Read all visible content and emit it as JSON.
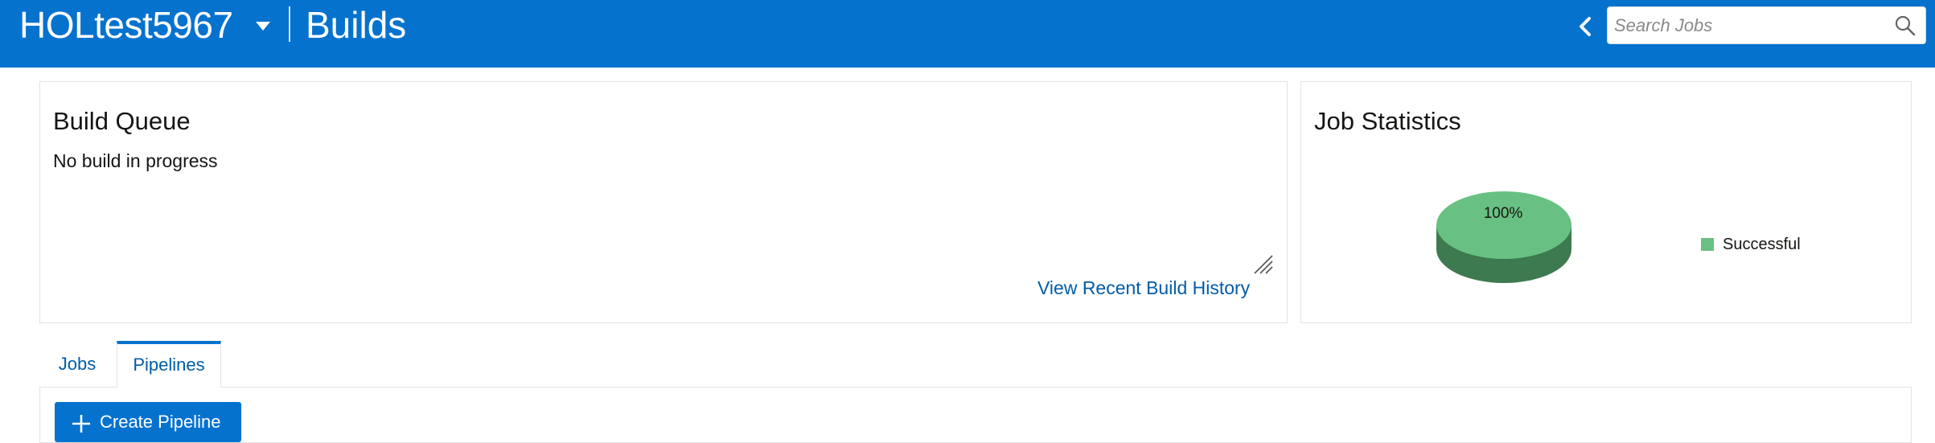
{
  "header": {
    "project_name": "HOLtest5967",
    "page_title": "Builds",
    "search_placeholder": "Search Jobs",
    "icons": [
      "chevron-down-icon",
      "chevron-left-icon",
      "search-icon"
    ]
  },
  "build_queue": {
    "title": "Build Queue",
    "status": "No build in progress",
    "history_link": "View Recent Build History"
  },
  "job_statistics": {
    "title": "Job Statistics",
    "slice_label": "100%",
    "legend_label": "Successful",
    "colors": {
      "successful": "#68c182",
      "successful_side": "#3d7a4f"
    }
  },
  "tabs": [
    {
      "label": "Jobs",
      "selected": false
    },
    {
      "label": "Pipelines",
      "selected": true
    }
  ],
  "pipelines": {
    "create_button": "Create Pipeline"
  },
  "colors": {
    "brand": "#0572ce",
    "link": "#005da8"
  }
}
